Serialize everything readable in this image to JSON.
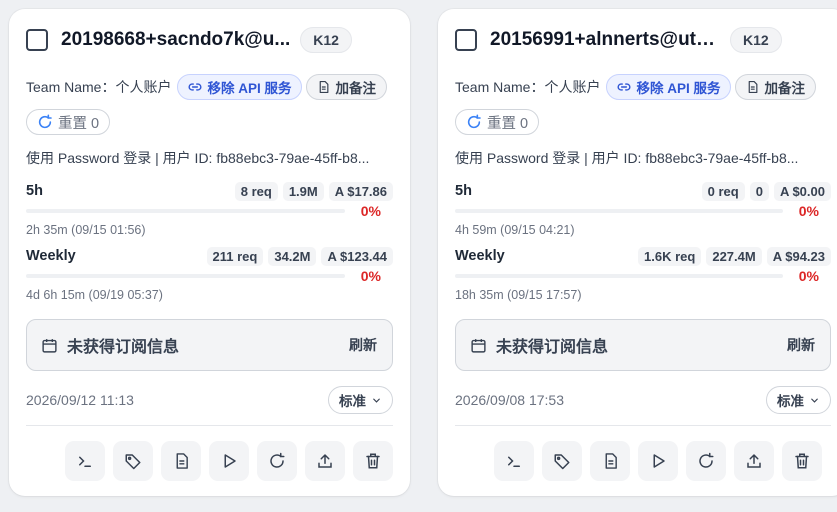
{
  "accounts": [
    {
      "email": "20198668+sacndo7k@u...",
      "plan": "K12",
      "team_label": "Team Name：个人账户",
      "remove_api_label": "移除 API 服务",
      "add_note_label": "加备注",
      "reset_label": "重置 0",
      "login_info": "使用 Password 登录 | 用户 ID: fb88ebc3-79ae-45ff-b8...",
      "usage": [
        {
          "title": "5h",
          "req": "8 req",
          "tokens": "1.9M",
          "cost": "A $17.86",
          "percent": "0%",
          "percent_value": 0,
          "reset": "2h 35m (09/15 01:56)"
        },
        {
          "title": "Weekly",
          "req": "211 req",
          "tokens": "34.2M",
          "cost": "A $123.44",
          "percent": "0%",
          "percent_value": 0,
          "reset": "4d 6h 15m (09/19 05:37)"
        }
      ],
      "subscription_text": "未获得订阅信息",
      "refresh_label": "刷新",
      "date": "2026/09/12 11:13",
      "mode": "标准"
    },
    {
      "email": "20156991+alnnerts@utc...",
      "plan": "K12",
      "team_label": "Team Name：个人账户",
      "remove_api_label": "移除 API 服务",
      "add_note_label": "加备注",
      "reset_label": "重置 0",
      "login_info": "使用 Password 登录 | 用户 ID: fb88ebc3-79ae-45ff-b8...",
      "usage": [
        {
          "title": "5h",
          "req": "0 req",
          "tokens": "0",
          "cost": "A $0.00",
          "percent": "0%",
          "percent_value": 0,
          "reset": "4h 59m (09/15 04:21)"
        },
        {
          "title": "Weekly",
          "req": "1.6K req",
          "tokens": "227.4M",
          "cost": "A $94.23",
          "percent": "0%",
          "percent_value": 0,
          "reset": "18h 35m (09/15 17:57)"
        }
      ],
      "subscription_text": "未获得订阅信息",
      "refresh_label": "刷新",
      "date": "2026/09/08 17:53",
      "mode": "标准"
    }
  ],
  "colors": {
    "accent_blue": "#2f55d4",
    "danger": "#dc2626",
    "card_bg": "#ffffff",
    "page_bg": "#eef0f3"
  },
  "action_icons": [
    "terminal-icon",
    "tag-icon",
    "document-icon",
    "play-icon",
    "refresh-icon",
    "upload-icon",
    "trash-icon"
  ]
}
